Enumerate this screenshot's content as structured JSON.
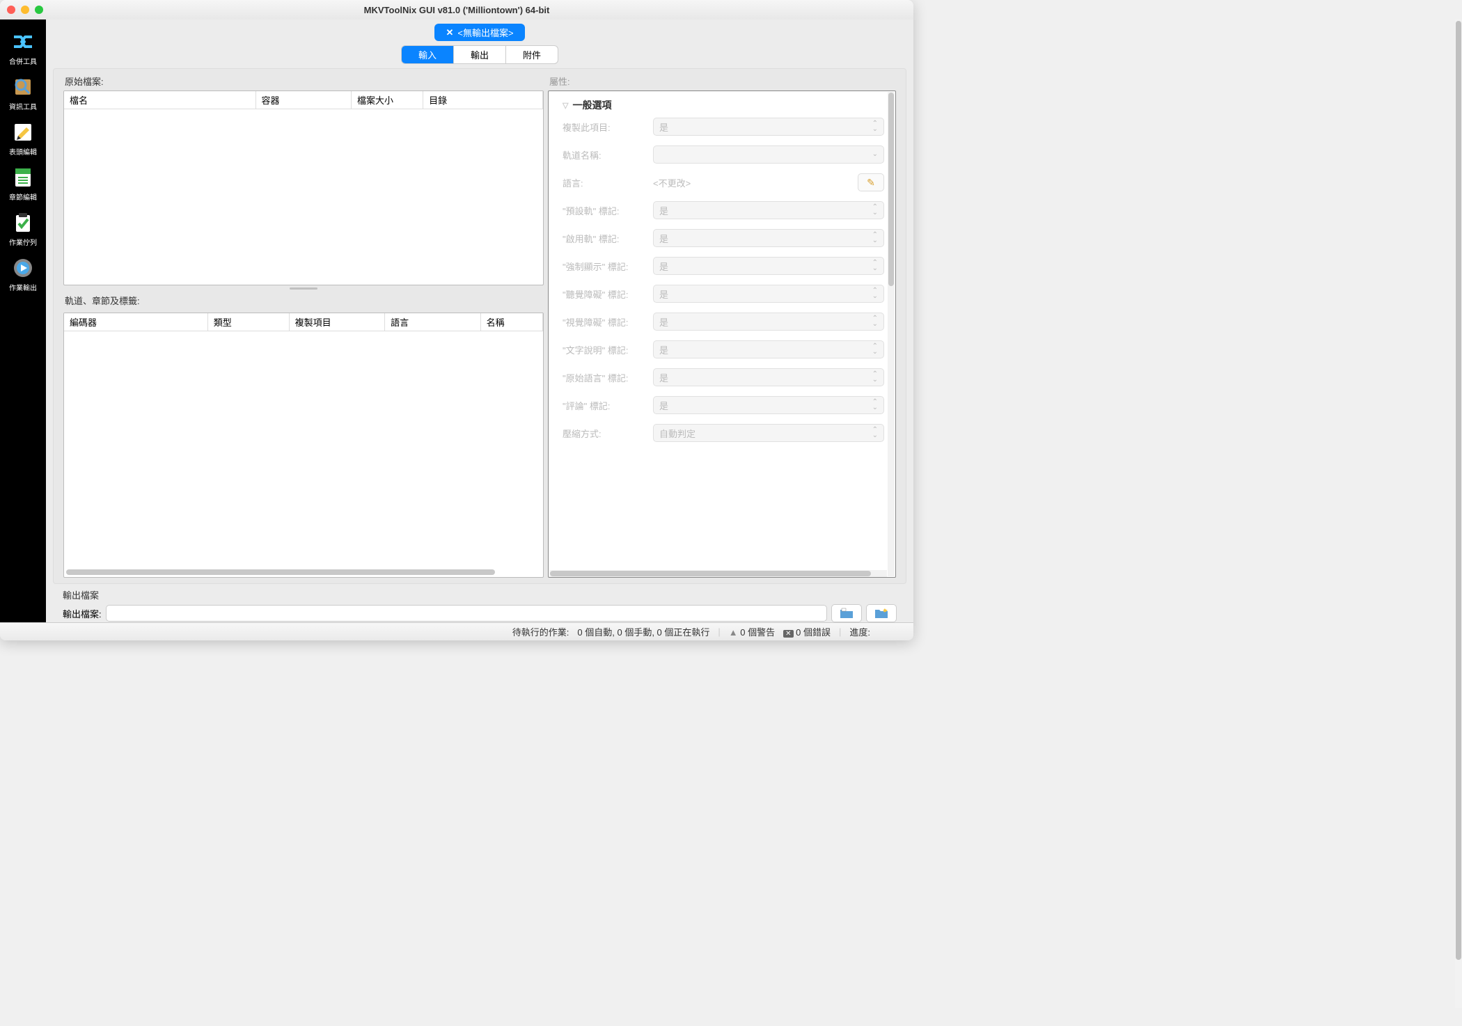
{
  "window": {
    "title": "MKVToolNix GUI v81.0 ('Milliontown') 64-bit"
  },
  "sidebar": {
    "items": [
      {
        "label": "合併工具"
      },
      {
        "label": "資訊工具"
      },
      {
        "label": "表頭編輯"
      },
      {
        "label": "章節編輯"
      },
      {
        "label": "作業佇列"
      },
      {
        "label": "作業輸出"
      }
    ]
  },
  "top_tab": {
    "close": "✕",
    "label": "<無輸出檔案>"
  },
  "segmented": {
    "input": "輸入",
    "output": "輸出",
    "attachments": "附件"
  },
  "files_section": {
    "label": "原始檔案:",
    "columns": {
      "name": "檔名",
      "container": "容器",
      "size": "檔案大小",
      "dir": "目錄"
    }
  },
  "tracks_section": {
    "label": "軌道、章節及標籤:",
    "columns": {
      "codec": "編碼器",
      "type": "類型",
      "copy": "複製項目",
      "lang": "語言",
      "name": "名稱"
    }
  },
  "props": {
    "label": "屬性:",
    "header": "一般選項",
    "rows": {
      "copy_item": {
        "label": "複製此項目:",
        "value": "是"
      },
      "track_name": {
        "label": "軌道名稱:",
        "value": ""
      },
      "language": {
        "label": "語言:",
        "value": "<不更改>"
      },
      "default_flag": {
        "label": "\"預設軌\" 標記:",
        "value": "是"
      },
      "enabled_flag": {
        "label": "\"啟用軌\" 標記:",
        "value": "是"
      },
      "forced_flag": {
        "label": "\"強制顯示\" 標記:",
        "value": "是"
      },
      "hearing_flag": {
        "label": "\"聽覺障礙\" 標記:",
        "value": "是"
      },
      "visual_flag": {
        "label": "\"視覺障礙\" 標記:",
        "value": "是"
      },
      "text_desc_flag": {
        "label": "\"文字說明\" 標記:",
        "value": "是"
      },
      "orig_lang_flag": {
        "label": "\"原始語言\" 標記:",
        "value": "是"
      },
      "commentary_flag": {
        "label": "\"評論\" 標記:",
        "value": "是"
      },
      "compression": {
        "label": "壓縮方式:",
        "value": "自動判定"
      }
    }
  },
  "output_file": {
    "section": "輸出檔案",
    "label": "輸出檔案:"
  },
  "status": {
    "pending_label": "待執行的作業:",
    "pending_text": "0 個自動, 0 個手動, 0 個正在執行",
    "warnings": "0 個警告",
    "errors": "0 個錯誤",
    "progress": "進度:"
  }
}
